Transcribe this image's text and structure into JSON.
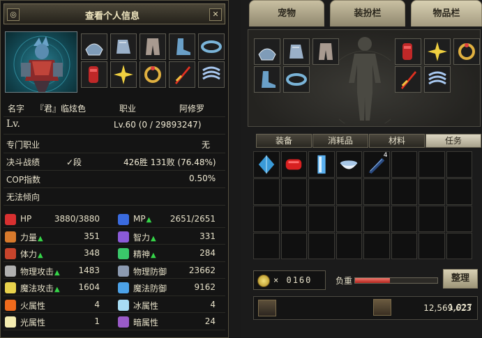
{
  "window": {
    "title": "查看个人信息",
    "close_glyph": "✕",
    "menu_glyph": "◎"
  },
  "info": {
    "name_label": "名字",
    "name_value": "『君』临炫色",
    "job_label": "职业",
    "job_value": "阿修罗",
    "lv_label": "Lv.",
    "lv_value": "Lv.60  (0 / 29893247)",
    "special_job_label": "专门职业",
    "special_job_value": "无",
    "duel_label": "决斗战绩",
    "duel_rank": "✓段",
    "duel_value": "426胜 131败 (76.48%)",
    "cop_label": "COP指数",
    "cop_value": "0.50%",
    "tendency_label": "无法倾向"
  },
  "stats": [
    {
      "label": "HP",
      "value": "3880/3880",
      "icon": "heart-icon",
      "color": "#d83030",
      "up": false
    },
    {
      "label": "MP",
      "value": "2651/2651",
      "icon": "shield-heart-icon",
      "color": "#3a6be0",
      "up": true
    },
    {
      "label": "力量",
      "value": "351",
      "icon": "strength-icon",
      "color": "#d87a2c",
      "up": true
    },
    {
      "label": "智力",
      "value": "331",
      "icon": "intelligence-icon",
      "color": "#8a5ad8",
      "up": true
    },
    {
      "label": "体力",
      "value": "348",
      "icon": "vitality-icon",
      "color": "#c8442c",
      "up": true
    },
    {
      "label": "精神",
      "value": "284",
      "icon": "spirit-icon",
      "color": "#3ac86a",
      "up": true
    },
    {
      "label": "物理攻击",
      "value": "1483",
      "icon": "physical-attack-icon",
      "color": "#b0b0b0",
      "up": true
    },
    {
      "label": "物理防御",
      "value": "23662",
      "icon": "physical-defense-icon",
      "color": "#8c9ab0",
      "up": false
    },
    {
      "label": "魔法攻击",
      "value": "1604",
      "icon": "magic-attack-icon",
      "color": "#e8d24c",
      "up": true
    },
    {
      "label": "魔法防御",
      "value": "9162",
      "icon": "magic-defense-icon",
      "color": "#4ca2e8",
      "up": false
    },
    {
      "label": "火属性",
      "value": "4",
      "icon": "fire-icon",
      "color": "#f06a1c",
      "up": false
    },
    {
      "label": "冰属性",
      "value": "4",
      "icon": "ice-icon",
      "color": "#a8dcf4",
      "up": false
    },
    {
      "label": "光属性",
      "value": "1",
      "icon": "light-icon",
      "color": "#f4ecb0",
      "up": false
    },
    {
      "label": "暗属性",
      "value": "24",
      "icon": "dark-icon",
      "color": "#9a5ac8",
      "up": false
    }
  ],
  "equipment_left": [
    "shoulder-armor-icon",
    "gauntlet-icon",
    "pants-icon",
    "boots-icon",
    "belt-icon",
    "bracer-icon",
    "star-ornament-icon",
    "ring-icon",
    "red-sword-icon",
    "wind-scroll-icon"
  ],
  "tabs": {
    "pet": "宠物",
    "avatar": "装扮栏",
    "items": "物品栏"
  },
  "subtabs": [
    "装备",
    "消耗品",
    "材料",
    "任务"
  ],
  "active_subtab": 3,
  "doll_slots_left": [
    "shoulder-armor-icon",
    "gauntlet-icon",
    "pants-icon",
    "boots-icon",
    "belt-icon"
  ],
  "doll_slots_right": [
    "bracer-icon",
    "star-ornament-icon",
    "ring-icon",
    "red-sword-icon",
    "wind-scroll-icon"
  ],
  "bag_items": [
    {
      "icon": "blue-crystal-icon",
      "count": ""
    },
    {
      "icon": "red-scroll-icon",
      "count": ""
    },
    {
      "icon": "ice-pillar-icon",
      "count": ""
    },
    {
      "icon": "white-bowl-icon",
      "count": ""
    },
    {
      "icon": "dark-blade-icon",
      "count": "4"
    }
  ],
  "bag_total_slots": 32,
  "coins": {
    "prefix": "×",
    "count": "0160"
  },
  "weight": {
    "label": "负重",
    "fraction": 0.42
  },
  "sort_button": "整理",
  "gold": "12,569,623",
  "cera": "1,027"
}
